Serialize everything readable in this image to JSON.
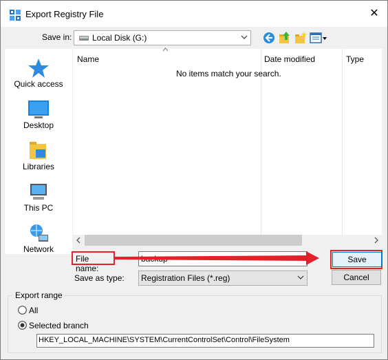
{
  "dialog": {
    "title": "Export Registry File",
    "close_glyph": "✕"
  },
  "save_in": {
    "label": "Save in:",
    "value": "Local Disk (G:)"
  },
  "places": [
    {
      "label": "Quick access",
      "icon": "star-icon"
    },
    {
      "label": "Desktop",
      "icon": "desktop-icon"
    },
    {
      "label": "Libraries",
      "icon": "libraries-icon"
    },
    {
      "label": "This PC",
      "icon": "computer-icon"
    },
    {
      "label": "Network",
      "icon": "network-icon"
    }
  ],
  "file_list": {
    "columns": [
      "Name",
      "Date modified",
      "Type"
    ],
    "empty_message": "No items match your search."
  },
  "file_name": {
    "label": "File name:",
    "value": "backup"
  },
  "save_as_type": {
    "label": "Save as type:",
    "value": "Registration Files (*.reg)"
  },
  "buttons": {
    "save": "Save",
    "cancel": "Cancel"
  },
  "export_range": {
    "title": "Export range",
    "all_label": "All",
    "selected_label": "Selected branch",
    "selected_option": "selected-branch",
    "branch_value": "HKEY_LOCAL_MACHINE\\SYSTEM\\CurrentControlSet\\Control\\FileSystem"
  },
  "colors": {
    "highlight_red": "#e3212b",
    "accent_blue": "#0078d7"
  }
}
